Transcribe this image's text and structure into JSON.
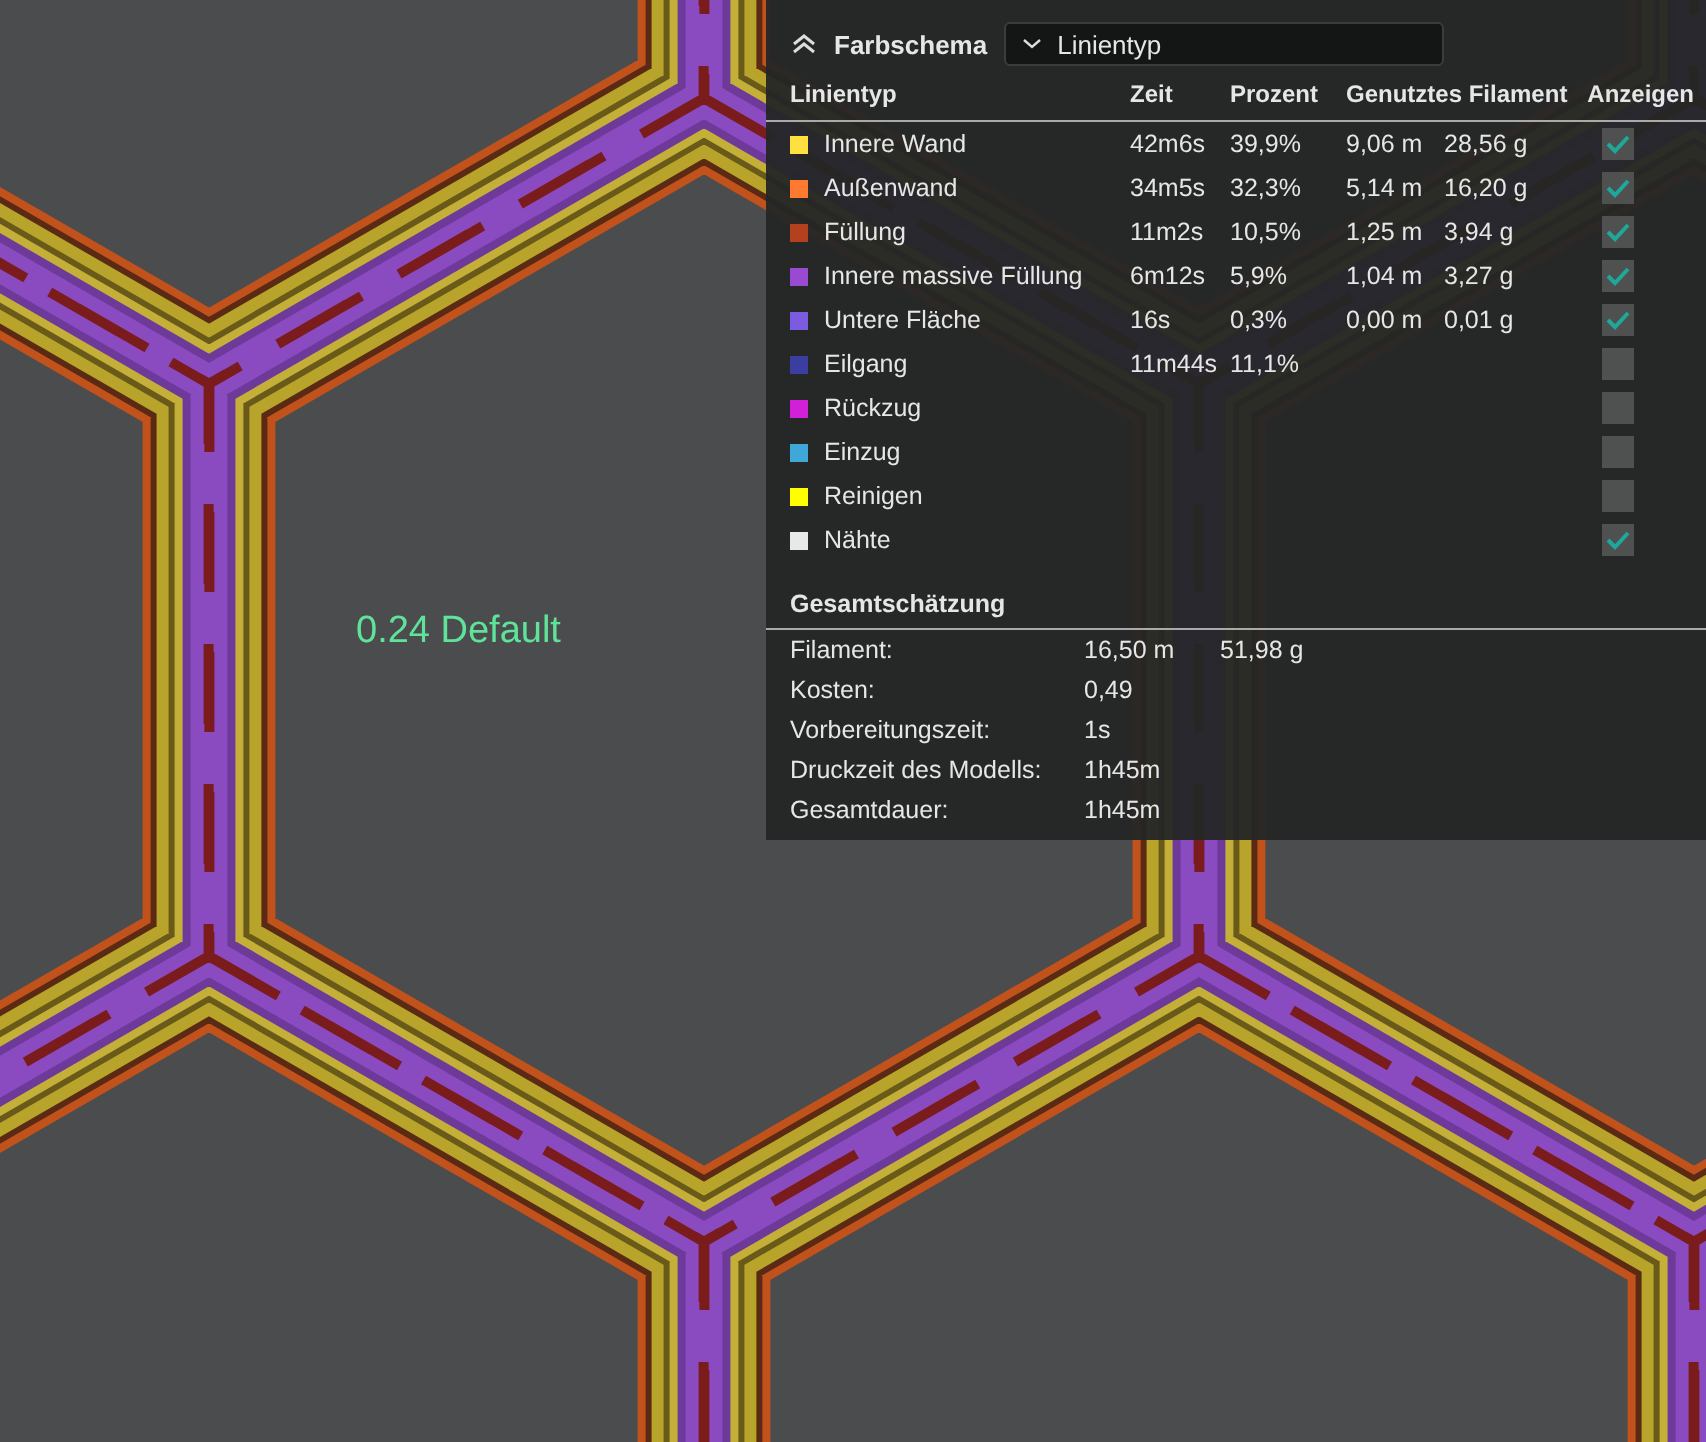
{
  "viewport": {
    "label": "0.24 Default"
  },
  "panel": {
    "title": "Farbschema",
    "dropdown": {
      "value": "Linientyp"
    },
    "columns": [
      "Linientyp",
      "Zeit",
      "Prozent",
      "Genutztes Filament",
      "Anzeigen"
    ],
    "rows": [
      {
        "name": "Innere Wand",
        "color": "#ffe040",
        "time": "42m6s",
        "percent": "39,9%",
        "length": "9,06 m",
        "weight": "28,56 g",
        "checked": true
      },
      {
        "name": "Außenwand",
        "color": "#ff7a30",
        "time": "34m5s",
        "percent": "32,3%",
        "length": "5,14 m",
        "weight": "16,20 g",
        "checked": true
      },
      {
        "name": "Füllung",
        "color": "#b3401f",
        "time": "11m2s",
        "percent": "10,5%",
        "length": "1,25 m",
        "weight": "3,94 g",
        "checked": true
      },
      {
        "name": "Innere massive Füllung",
        "color": "#9a4ad0",
        "time": "6m12s",
        "percent": "5,9%",
        "length": "1,04 m",
        "weight": "3,27 g",
        "checked": true
      },
      {
        "name": "Untere Fläche",
        "color": "#7b5be0",
        "time": "16s",
        "percent": "0,3%",
        "length": "0,00 m",
        "weight": "0,01 g",
        "checked": true
      },
      {
        "name": "Eilgang",
        "color": "#3a3ea0",
        "time": "11m44s",
        "percent": "11,1%",
        "checked": false
      },
      {
        "name": "Rückzug",
        "color": "#d020d8",
        "checked": false
      },
      {
        "name": "Einzug",
        "color": "#40a8d8",
        "checked": false
      },
      {
        "name": "Reinigen",
        "color": "#ffff00",
        "checked": false
      },
      {
        "name": "Nähte",
        "color": "#e8e8e8",
        "checked": true
      }
    ],
    "summary": {
      "title": "Gesamtschätzung",
      "rows": [
        {
          "label": "Filament:",
          "values": [
            "16,50 m",
            "51,98 g"
          ]
        },
        {
          "label": "Kosten:",
          "values": [
            "0,49"
          ]
        },
        {
          "label": "Vorbereitungszeit:",
          "values": [
            "1s"
          ]
        },
        {
          "label": "Druckzeit des Modells:",
          "values": [
            "1h45m"
          ]
        },
        {
          "label": "Gesamtdauer:",
          "values": [
            "1h45m"
          ]
        }
      ]
    }
  }
}
